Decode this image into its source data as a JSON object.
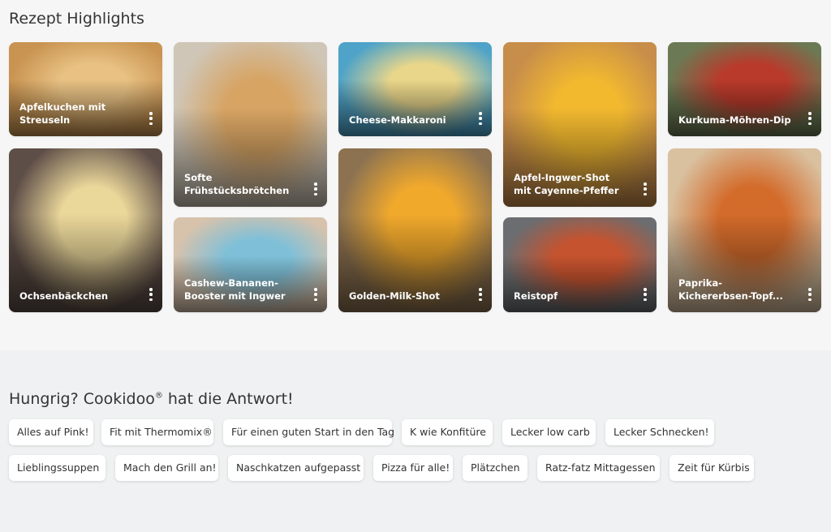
{
  "highlights": {
    "title": "Rezept Highlights",
    "cards": [
      {
        "label": "Apfelkuchen mit\nStreuseln",
        "bg": "#c99451",
        "bg2": "#e8c183"
      },
      {
        "label": "Softe\nFrühstücksbrötchen",
        "bg": "#cfc6b7",
        "bg2": "#d7a463"
      },
      {
        "label": "Cheese-Makkaroni",
        "bg": "#4fa3c8",
        "bg2": "#e9d68a"
      },
      {
        "label": "Apfel-Ingwer-Shot\nmit Cayenne-Pfeffer",
        "bg": "#c78d4b",
        "bg2": "#f2b92f"
      },
      {
        "label": "Kurkuma-Möhren-Dip",
        "bg": "#6b7a54",
        "bg2": "#b93a2b"
      },
      {
        "label": "Ochsenbäckchen",
        "bg": "#5e4e48",
        "bg2": "#ead79a"
      },
      {
        "label": "Cashew-Bananen-\nBooster mit Ingwer",
        "bg": "#d7c2ac",
        "bg2": "#7fc0d8"
      },
      {
        "label": "Golden-Milk-Shot",
        "bg": "#8c7251",
        "bg2": "#f1a92c"
      },
      {
        "label": "Reistopf",
        "bg": "#6b6d70",
        "bg2": "#c6532f"
      },
      {
        "label": "Paprika-\nKichererbsen-Topf...",
        "bg": "#d9c1a0",
        "bg2": "#d36b2b"
      }
    ]
  },
  "collections": {
    "title_main": "Hungrig? Cookidoo",
    "title_reg": "®",
    "title_end": " hat die Antwort!",
    "chips": [
      "Alles auf Pink!",
      "Fit mit Thermomix®",
      "Für einen guten Start in den Tag",
      "K wie Konfitüre",
      "Lecker low carb",
      "Lecker Schnecken!",
      "Lieblingssuppen",
      "Mach den Grill an!",
      "Naschkatzen aufgepasst",
      "Pizza für alle!",
      "Plätzchen",
      "Ratz-fatz Mittagessen",
      "Zeit für Kürbis"
    ]
  }
}
